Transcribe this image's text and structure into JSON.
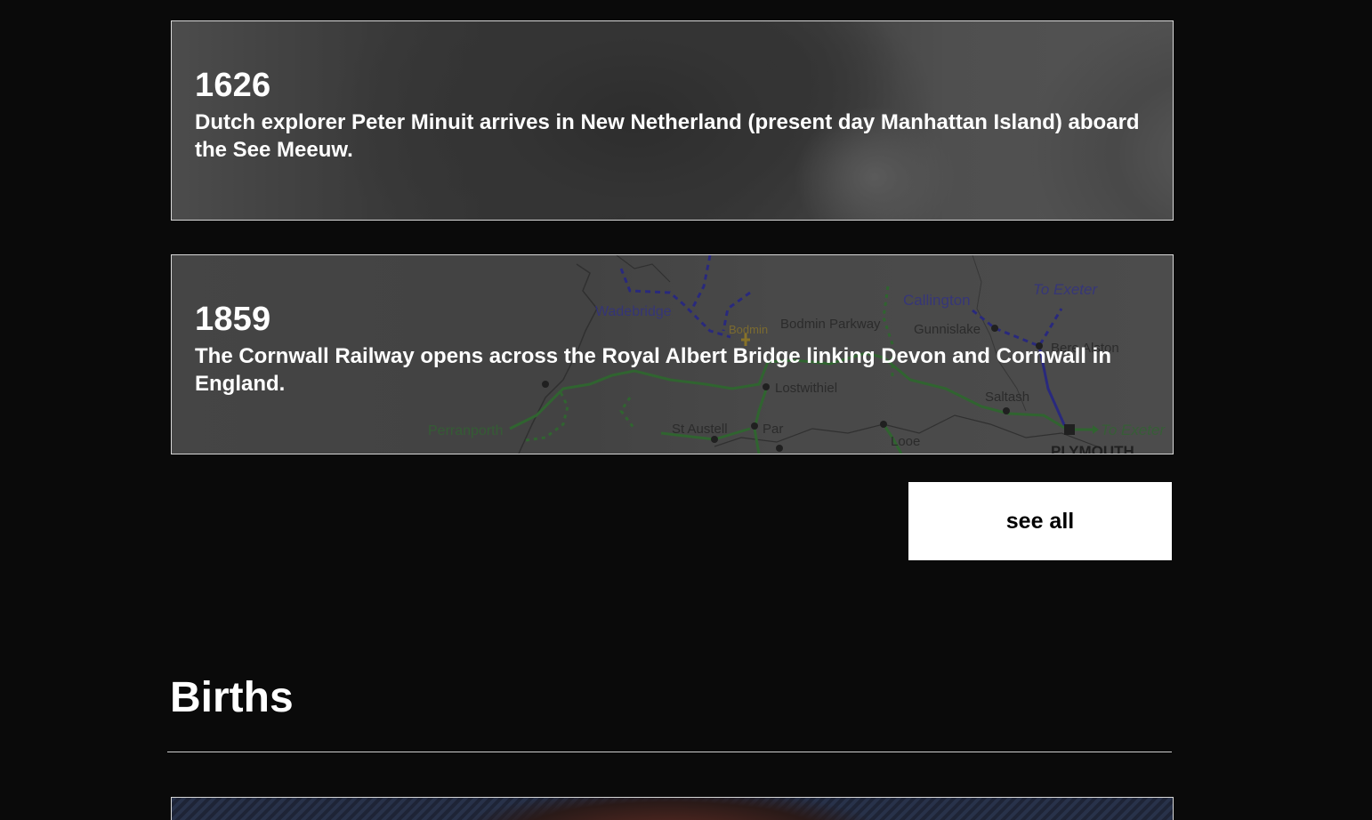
{
  "events": [
    {
      "year": "1626",
      "description": "Dutch explorer Peter Minuit arrives in New Netherland (present day Manhattan Island) aboard the See Meeuw."
    },
    {
      "year": "1859",
      "description": "The Cornwall Railway opens across the Royal Albert Bridge linking Devon and Cornwall in England."
    }
  ],
  "map_labels": {
    "wadebridge": "Wadebridge",
    "bodmin_parkway": "Bodmin Parkway",
    "bodmin": "Bodmin",
    "callington": "Callington",
    "gunnislake": "Gunnislake",
    "bere_alston": "Bere Alston",
    "to_exeter_top": "To Exeter",
    "lostwithiel": "Lostwithiel",
    "saltash": "Saltash",
    "to_exeter_bottom": "To Exeter",
    "perranporth": "Perranporth",
    "st_austell": "St Austell",
    "par": "Par",
    "looe": "Looe",
    "plymouth": "PLYMOUTH"
  },
  "see_all": {
    "label": "see all"
  },
  "births": {
    "title": "Births"
  },
  "colors": {
    "background": "#0a0a0a",
    "text": "#ffffff",
    "button_bg": "#ffffff",
    "button_text": "#000000",
    "card_border": "#d8d8d8"
  }
}
